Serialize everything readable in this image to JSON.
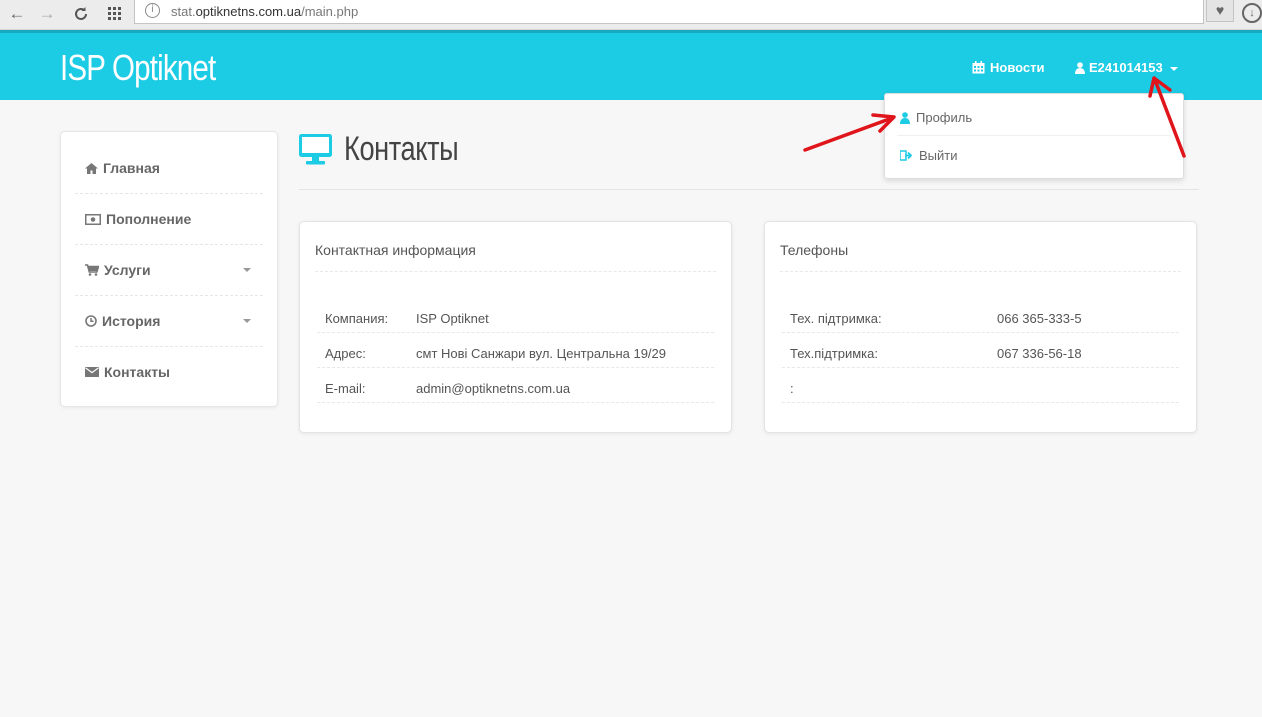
{
  "browser": {
    "url_prefix": "stat.",
    "url_domain": "optiknetns.com.ua",
    "url_path": "/main.php"
  },
  "header": {
    "brand": "ISP Optiknet",
    "news_label": "Новости",
    "user_label": "E241014153",
    "color": "#1ccbe4"
  },
  "user_menu": {
    "profile_label": "Профиль",
    "logout_label": "Выйти"
  },
  "sidebar": {
    "items": [
      {
        "label": "Главная",
        "icon": "home-icon"
      },
      {
        "label": "Пополнение",
        "icon": "money-icon"
      },
      {
        "label": "Услуги",
        "icon": "cart-icon"
      },
      {
        "label": "История",
        "icon": "clock-icon"
      },
      {
        "label": "Контакты",
        "icon": "envelope-icon"
      }
    ]
  },
  "page": {
    "title": "Контакты",
    "icon": "monitor-icon"
  },
  "contact_card": {
    "title": "Контактная информация",
    "rows": [
      {
        "key": "Компания:",
        "value": "ISP Optiknet"
      },
      {
        "key": "Адрес:",
        "value": "смт Нові Санжари вул. Центральна 19/29"
      },
      {
        "key": "E-mail:",
        "value": "admin@optiknetns.com.ua"
      }
    ]
  },
  "phones_card": {
    "title": "Телефоны",
    "rows": [
      {
        "key": "Тех. підтримка:",
        "value": "066 365-333-5"
      },
      {
        "key": "Тех.підтримка:",
        "value": "067 336-56-18"
      },
      {
        "key": ":",
        "value": ""
      }
    ]
  }
}
